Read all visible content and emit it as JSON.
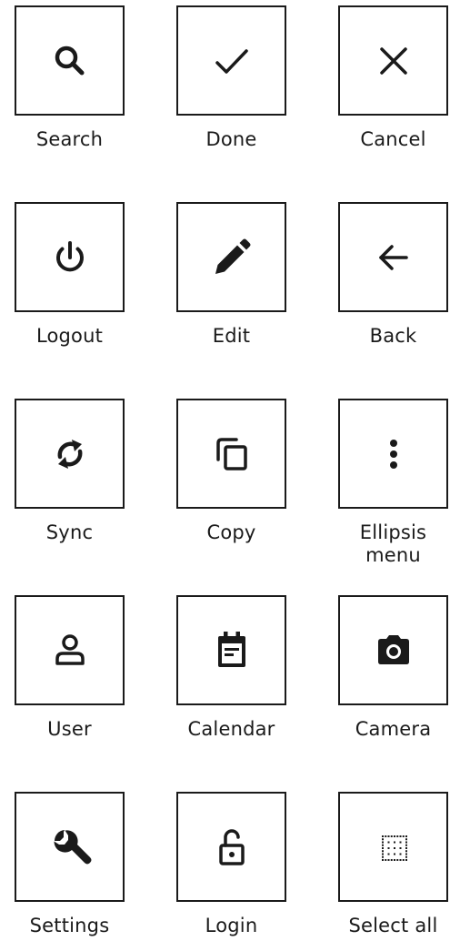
{
  "icons": [
    {
      "label": "Search",
      "icon": "search-icon"
    },
    {
      "label": "Done",
      "icon": "checkmark-icon"
    },
    {
      "label": "Cancel",
      "icon": "close-icon"
    },
    {
      "label": "Logout",
      "icon": "power-icon"
    },
    {
      "label": "Edit",
      "icon": "pencil-icon"
    },
    {
      "label": "Back",
      "icon": "arrow-left-icon"
    },
    {
      "label": "Sync",
      "icon": "sync-icon"
    },
    {
      "label": "Copy",
      "icon": "copy-icon"
    },
    {
      "label": "Ellipsis menu",
      "icon": "ellipsis-vertical-icon"
    },
    {
      "label": "User",
      "icon": "user-icon"
    },
    {
      "label": "Calendar",
      "icon": "calendar-icon"
    },
    {
      "label": "Camera",
      "icon": "camera-icon"
    },
    {
      "label": "Settings",
      "icon": "wrench-icon"
    },
    {
      "label": "Login",
      "icon": "unlock-icon"
    },
    {
      "label": "Select all",
      "icon": "select-all-icon"
    }
  ],
  "colors": {
    "stroke": "#1a1a1a",
    "background": "#ffffff"
  }
}
